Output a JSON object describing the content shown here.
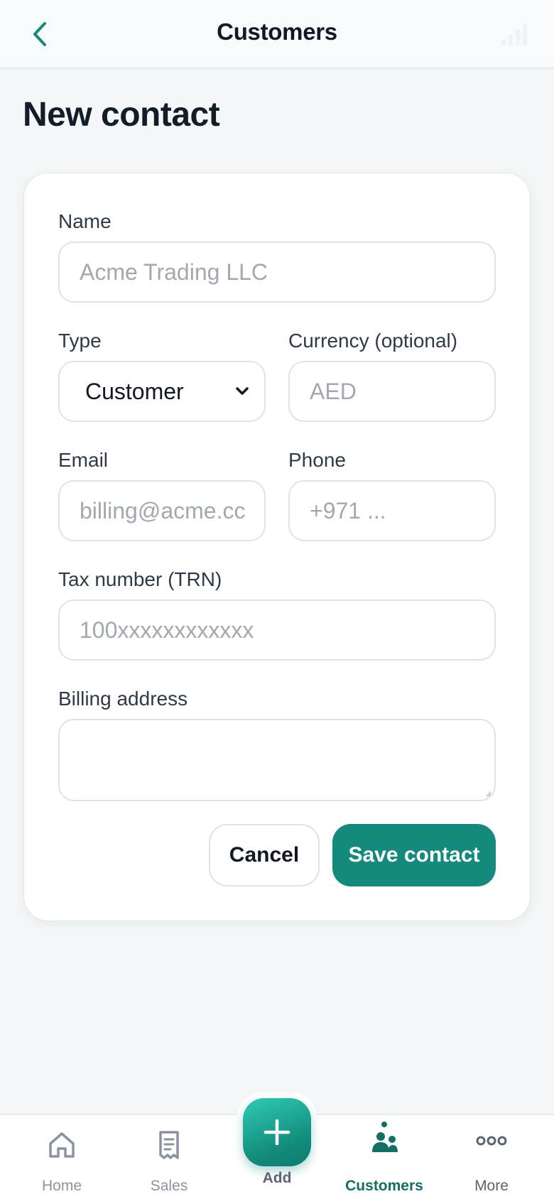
{
  "header": {
    "title": "Customers",
    "back_icon": "chevron-left-icon",
    "status_icon": "signal-icon"
  },
  "page": {
    "title": "New contact"
  },
  "form": {
    "name": {
      "label": "Name",
      "placeholder": "Acme Trading LLC",
      "value": ""
    },
    "type": {
      "label": "Type",
      "value": "Customer"
    },
    "currency": {
      "label": "Currency (optional)",
      "placeholder": "AED",
      "value": ""
    },
    "email": {
      "label": "Email",
      "placeholder": "billing@acme.cc",
      "value": ""
    },
    "phone": {
      "label": "Phone",
      "placeholder": "+971 ...",
      "value": ""
    },
    "tax_number": {
      "label": "Tax number (TRN)",
      "placeholder": "100xxxxxxxxxxxx",
      "value": ""
    },
    "billing_address": {
      "label": "Billing address",
      "value": ""
    },
    "cancel_label": "Cancel",
    "save_label": "Save contact"
  },
  "nav": {
    "items": [
      {
        "label": "Home",
        "icon": "home-icon",
        "active": false
      },
      {
        "label": "Sales",
        "icon": "receipt-icon",
        "active": false
      },
      {
        "label": "Add",
        "icon": "plus-icon",
        "active": false
      },
      {
        "label": "Customers",
        "icon": "people-icon",
        "active": true
      },
      {
        "label": "More",
        "icon": "more-dots-icon",
        "active": false
      }
    ]
  },
  "colors": {
    "accent": "#138a7b",
    "accent_dark": "#126f66",
    "background": "#f4f7f7",
    "text_primary": "#111827",
    "placeholder": "#a2a8b2"
  }
}
